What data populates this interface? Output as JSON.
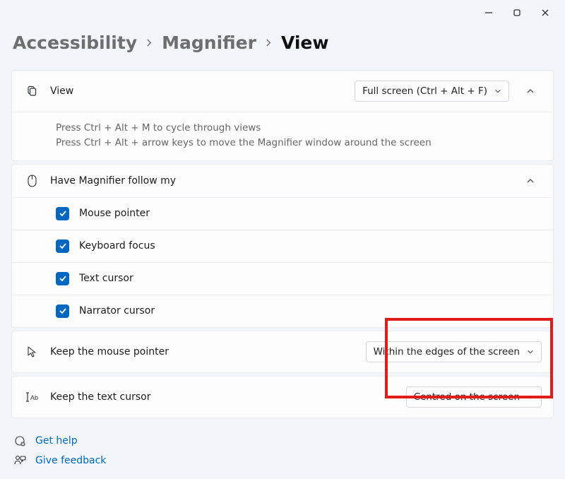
{
  "breadcrumb": {
    "accessibility": "Accessibility",
    "magnifier": "Magnifier",
    "view": "View"
  },
  "view_card": {
    "label": "View",
    "dropdown_value": "Full screen (Ctrl + Alt + F)",
    "tip_line1": "Press Ctrl + Alt + M to cycle through views",
    "tip_line2": "Press Ctrl + Alt + arrow keys to move the Magnifier window around the screen"
  },
  "follow_card": {
    "label": "Have Magnifier follow my",
    "options": [
      {
        "label": "Mouse pointer",
        "checked": true
      },
      {
        "label": "Keyboard focus",
        "checked": true
      },
      {
        "label": "Text cursor",
        "checked": true
      },
      {
        "label": "Narrator cursor",
        "checked": true
      }
    ]
  },
  "mouse_row": {
    "label": "Keep the mouse pointer",
    "value": "Within the edges of the screen"
  },
  "text_row": {
    "label": "Keep the text cursor",
    "value": "Centred on the screen"
  },
  "footer": {
    "get_help": "Get help",
    "give_feedback": "Give feedback"
  }
}
